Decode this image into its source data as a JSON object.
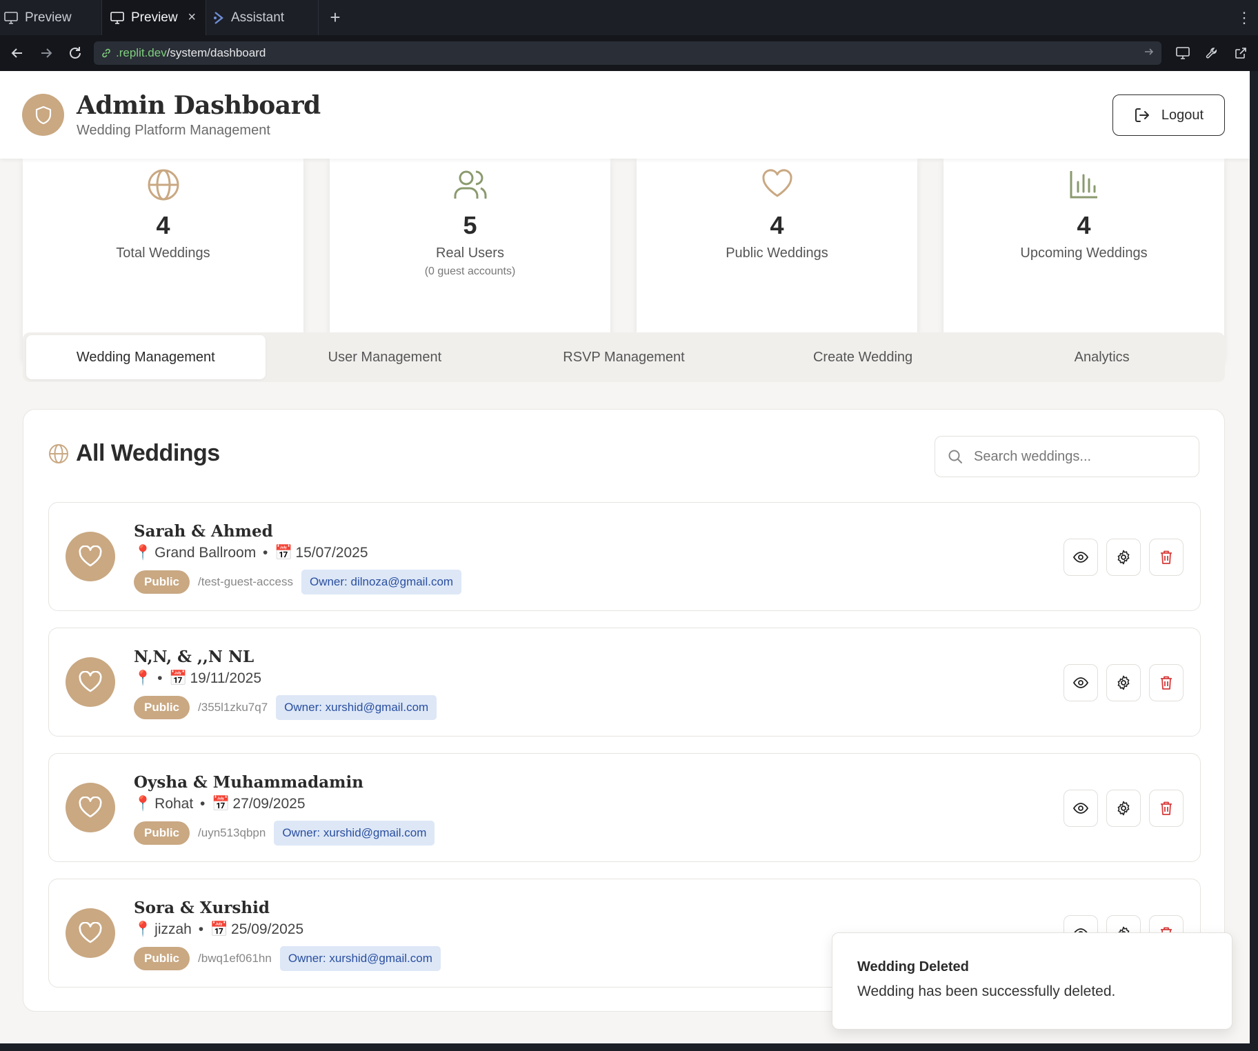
{
  "browser": {
    "tabs": [
      {
        "label": "Preview",
        "icon": "monitor-icon"
      },
      {
        "label": "Preview",
        "icon": "monitor-icon",
        "active": true
      },
      {
        "label": "Assistant",
        "icon": "assistant-icon"
      }
    ],
    "url_host": ".replit.dev",
    "url_path": "/system/dashboard"
  },
  "header": {
    "title": "Admin Dashboard",
    "subtitle": "Wedding Platform Management",
    "logout_label": "Logout"
  },
  "stats": [
    {
      "value": "4",
      "label": "Total Weddings",
      "icon": "globe-icon"
    },
    {
      "value": "5",
      "label": "Real Users",
      "note": "(0 guest accounts)",
      "icon": "users-icon"
    },
    {
      "value": "4",
      "label": "Public Weddings",
      "icon": "heart-icon"
    },
    {
      "value": "4",
      "label": "Upcoming Weddings",
      "icon": "bar-chart-icon"
    }
  ],
  "tabs": [
    {
      "label": "Wedding Management",
      "active": true
    },
    {
      "label": "User Management"
    },
    {
      "label": "RSVP Management"
    },
    {
      "label": "Create Wedding"
    },
    {
      "label": "Analytics"
    }
  ],
  "panel": {
    "title": "All Weddings",
    "search_placeholder": "Search weddings..."
  },
  "weddings": [
    {
      "name": "Sarah & Ahmed",
      "venue": "Grand Ballroom",
      "date": "15/07/2025",
      "status": "Public",
      "slug": "/test-guest-access",
      "owner": "Owner: dilnoza@gmail.com"
    },
    {
      "name": "N,N, & ,,N NL",
      "venue": "",
      "date": "19/11/2025",
      "status": "Public",
      "slug": "/355l1zku7q7",
      "owner": "Owner: xurshid@gmail.com"
    },
    {
      "name": "Oysha & Muhammadamin",
      "venue": "Rohat",
      "date": "27/09/2025",
      "status": "Public",
      "slug": "/uyn513qbpn",
      "owner": "Owner: xurshid@gmail.com"
    },
    {
      "name": "Sora & Xurshid",
      "venue": "jizzah",
      "date": "25/09/2025",
      "status": "Public",
      "slug": "/bwq1ef061hn",
      "owner": "Owner: xurshid@gmail.com"
    }
  ],
  "toast": {
    "title": "Wedding Deleted",
    "message": "Wedding has been successfully deleted."
  },
  "colors": {
    "accent": "#c9a882",
    "danger": "#d63a3a",
    "owner_bg": "#dde7f6",
    "owner_text": "#2a4fa0"
  }
}
